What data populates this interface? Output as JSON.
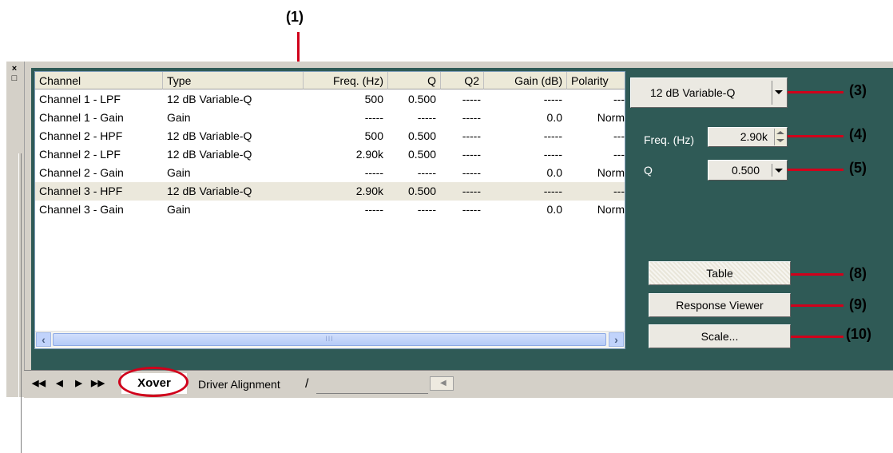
{
  "callouts": {
    "c1": "(1)",
    "c3": "(3)",
    "c4": "(4)",
    "c5": "(5)",
    "c8": "(8)",
    "c9": "(9)",
    "c10": "(10)"
  },
  "system_buttons": {
    "close": "×",
    "restore": "□"
  },
  "list": {
    "columns": [
      "Channel",
      "Type",
      "Freq. (Hz)",
      "Q",
      "Q2",
      "Gain (dB)",
      "Polarity"
    ],
    "rows": [
      {
        "channel": "Channel 1 - LPF",
        "type": "12 dB Variable-Q",
        "freq": "500",
        "q": "0.500",
        "q2": "-----",
        "gain": "-----",
        "polarity": "---"
      },
      {
        "channel": "Channel 1 - Gain",
        "type": "Gain",
        "freq": "-----",
        "q": "-----",
        "q2": "-----",
        "gain": "0.0",
        "polarity": "Norm"
      },
      {
        "channel": "Channel 2 - HPF",
        "type": "12 dB Variable-Q",
        "freq": "500",
        "q": "0.500",
        "q2": "-----",
        "gain": "-----",
        "polarity": "---"
      },
      {
        "channel": "Channel 2 - LPF",
        "type": "12 dB Variable-Q",
        "freq": "2.90k",
        "q": "0.500",
        "q2": "-----",
        "gain": "-----",
        "polarity": "---"
      },
      {
        "channel": "Channel 2 - Gain",
        "type": "Gain",
        "freq": "-----",
        "q": "-----",
        "q2": "-----",
        "gain": "0.0",
        "polarity": "Norm"
      },
      {
        "channel": "Channel 3 - HPF",
        "type": "12 dB Variable-Q",
        "freq": "2.90k",
        "q": "0.500",
        "q2": "-----",
        "gain": "-----",
        "polarity": "---"
      },
      {
        "channel": "Channel 3 - Gain",
        "type": "Gain",
        "freq": "-----",
        "q": "-----",
        "q2": "-----",
        "gain": "0.0",
        "polarity": "Norm"
      }
    ],
    "selected_row": 5,
    "scroll_grip": "III"
  },
  "controls": {
    "filter_type": "12 dB Variable-Q",
    "freq_label": "Freq. (Hz)",
    "freq_value": "2.90k",
    "q_label": "Q",
    "q_value": "0.500",
    "table_button": "Table",
    "response_viewer_button": "Response Viewer",
    "scale_button": "Scale..."
  },
  "tabs": {
    "active": "Xover",
    "other": "Driver Alignment"
  },
  "colors": {
    "panel_bg": "#2f5a56",
    "callout_red": "#d0001b",
    "selected_row": "#ebe8dc"
  }
}
